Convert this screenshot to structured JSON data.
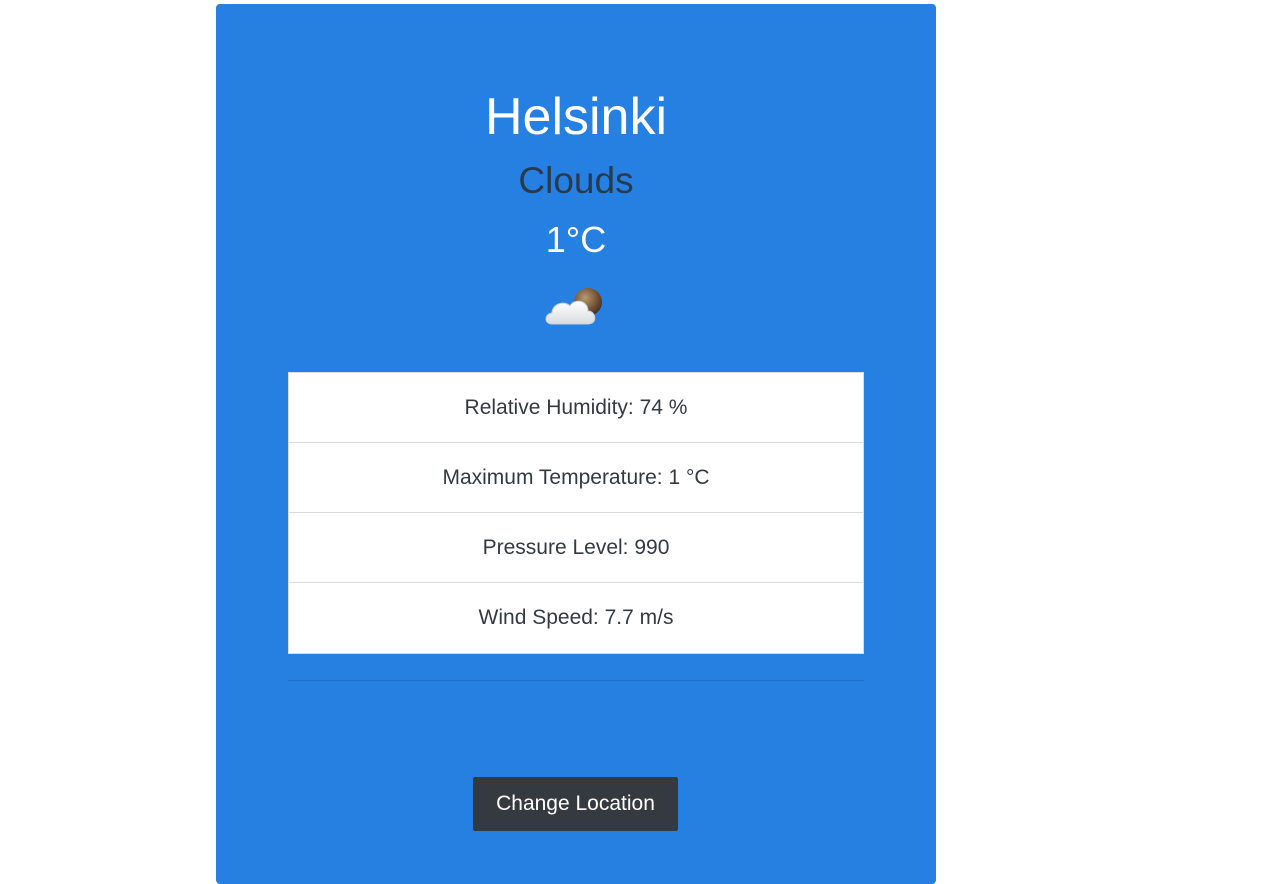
{
  "weather": {
    "city": "Helsinki",
    "condition": "Clouds",
    "temperature": "1°C",
    "icon": "cloud-with-moon-icon"
  },
  "details": [
    {
      "label": "Relative Humidity: 74 %"
    },
    {
      "label": "Maximum Temperature: 1 °C"
    },
    {
      "label": "Pressure Level: 990"
    },
    {
      "label": "Wind Speed: 7.7 m/s"
    }
  ],
  "actions": {
    "change_location_label": "Change Location"
  },
  "colors": {
    "card_background": "#2680e2",
    "button_background": "#343a40"
  }
}
